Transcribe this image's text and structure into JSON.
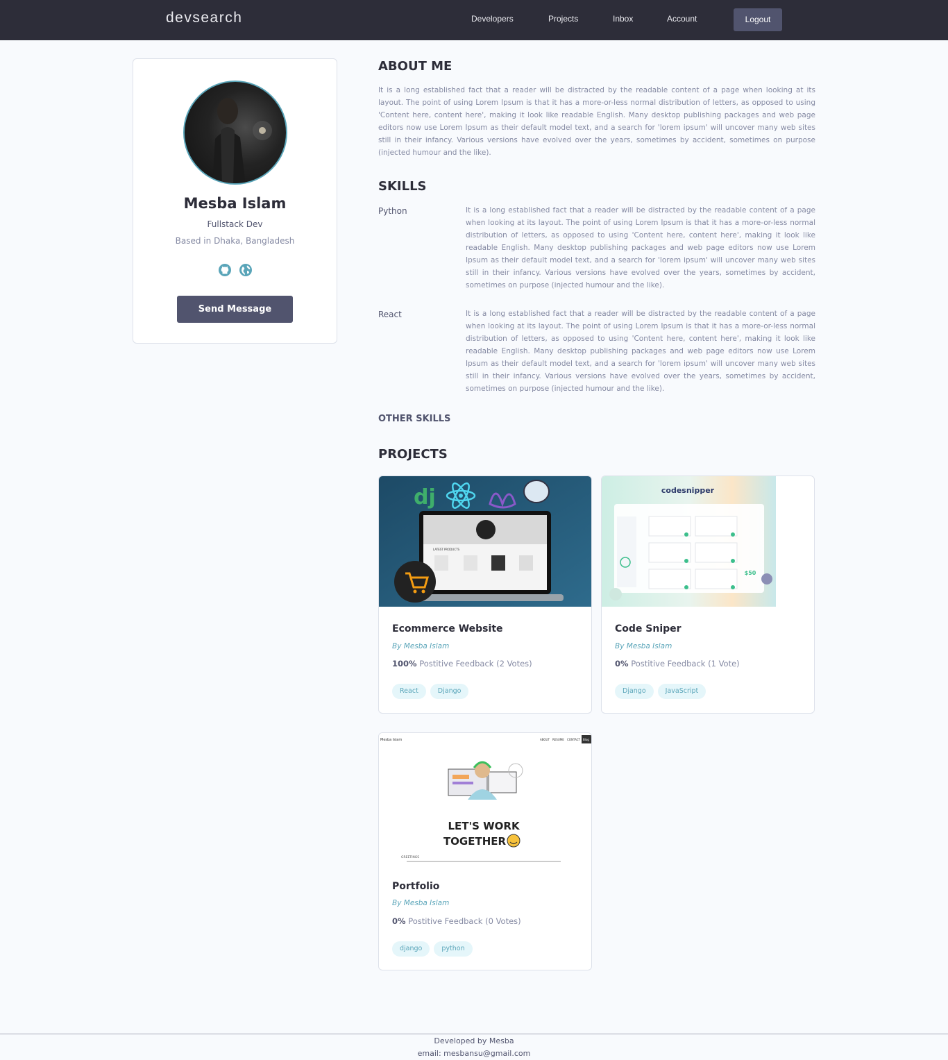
{
  "nav": {
    "logo": "devsearch",
    "links": [
      "Developers",
      "Projects",
      "Inbox",
      "Account"
    ],
    "logout": "Logout"
  },
  "profile": {
    "name": "Mesba Islam",
    "role": "Fullstack Dev",
    "location": "Based in Dhaka, Bangladesh",
    "socials": [
      "github-icon",
      "globe-icon"
    ],
    "send_message": "Send Message"
  },
  "about": {
    "title": "ABOUT ME",
    "text": "It is a long established fact that a reader will be distracted by the readable content of a page when looking at its layout. The point of using Lorem Ipsum is that it has a more-or-less normal distribution of letters, as opposed to using 'Content here, content here', making it look like readable English. Many desktop publishing packages and web page editors now use Lorem Ipsum as their default model text, and a search for 'lorem ipsum' will uncover many web sites still in their infancy. Various versions have evolved over the years, sometimes by accident, sometimes on purpose (injected humour and the like)."
  },
  "skills": {
    "title": "SKILLS",
    "items": [
      {
        "name": "Python",
        "description": "It is a long established fact that a reader will be distracted by the readable content of a page when looking at its layout. The point of using Lorem Ipsum is that it has a more-or-less normal distribution of letters, as opposed to using 'Content here, content here', making it look like readable English. Many desktop publishing packages and web page editors now use Lorem Ipsum as their default model text, and a search for 'lorem ipsum' will uncover many web sites still in their infancy. Various versions have evolved over the years, sometimes by accident, sometimes on purpose (injected humour and the like)."
      },
      {
        "name": "React",
        "description": "It is a long established fact that a reader will be distracted by the readable content of a page when looking at its layout. The point of using Lorem Ipsum is that it has a more-or-less normal distribution of letters, as opposed to using 'Content here, content here', making it look like readable English. Many desktop publishing packages and web page editors now use Lorem Ipsum as their default model text, and a search for 'lorem ipsum' will uncover many web sites still in their infancy. Various versions have evolved over the years, sometimes by accident, sometimes on purpose (injected humour and the like)."
      }
    ],
    "other_title": "OTHER SKILLS"
  },
  "projects": {
    "title": "PROJECTS",
    "items": [
      {
        "title": "Ecommerce Website",
        "owner": "By Mesba Islam",
        "percent": "100%",
        "feedback": "Postitive Feedback (2 Votes)",
        "tags": [
          "React",
          "Django"
        ],
        "thumb": {
          "section_label": "LATEST PRODUCTS"
        }
      },
      {
        "title": "Code Sniper",
        "owner": "By Mesba Islam",
        "percent": "0%",
        "feedback": "Postitive Feedback (1 Vote)",
        "tags": [
          "Django",
          "JavaScript"
        ],
        "thumb": {
          "brand": "codesnipper",
          "price": "$50"
        }
      },
      {
        "title": "Portfolio",
        "owner": "By Mesba Islam",
        "percent": "0%",
        "feedback": "Postitive Feedback (0 Votes)",
        "tags": [
          "django",
          "python"
        ],
        "thumb": {
          "site_name": "Mesba Islam",
          "nav": [
            "ABOUT",
            "RESUME",
            "CONTACT",
            "Blog"
          ],
          "headline_1": "LET'S WORK",
          "headline_2": "TOGETHER",
          "greeting": "GREETINGS"
        }
      }
    ]
  },
  "footer": {
    "line1": "Developed by Mesba",
    "line2": "email: mesbansu@gmail.com"
  },
  "colors": {
    "navbar": "#2d2d39",
    "button": "#51546e",
    "accent": "#5aa5b9",
    "tag_bg": "#e5f6fa"
  }
}
